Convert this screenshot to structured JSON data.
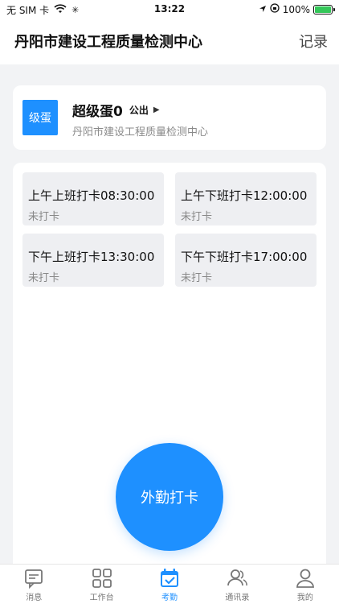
{
  "status_bar": {
    "carrier": "无 SIM 卡",
    "time": "13:22",
    "battery": "100%",
    "battery_level": 1.0
  },
  "nav": {
    "title": "丹阳市建设工程质量检测中心",
    "record": "记录"
  },
  "profile": {
    "badge": "级蛋",
    "name": "超级蛋0",
    "dept": "公出",
    "org": "丹阳市建设工程质量检测中心"
  },
  "attendance": {
    "slots": [
      {
        "title": "上午上班打卡08:30:00",
        "status": "未打卡"
      },
      {
        "title": "上午下班打卡12:00:00",
        "status": "未打卡"
      },
      {
        "title": "下午上班打卡13:30:00",
        "status": "未打卡"
      },
      {
        "title": "下午下班打卡17:00:00",
        "status": "未打卡"
      }
    ],
    "punch_button": "外勤打卡"
  },
  "tabs": [
    {
      "label": "消息",
      "icon": "message-icon"
    },
    {
      "label": "工作台",
      "icon": "grid-icon"
    },
    {
      "label": "考勤",
      "icon": "calendar-check-icon"
    },
    {
      "label": "通讯录",
      "icon": "contacts-icon"
    },
    {
      "label": "我的",
      "icon": "profile-icon"
    }
  ],
  "colors": {
    "accent": "#1e90ff",
    "muted": "#888888",
    "slot_bg": "#eeeff2"
  }
}
